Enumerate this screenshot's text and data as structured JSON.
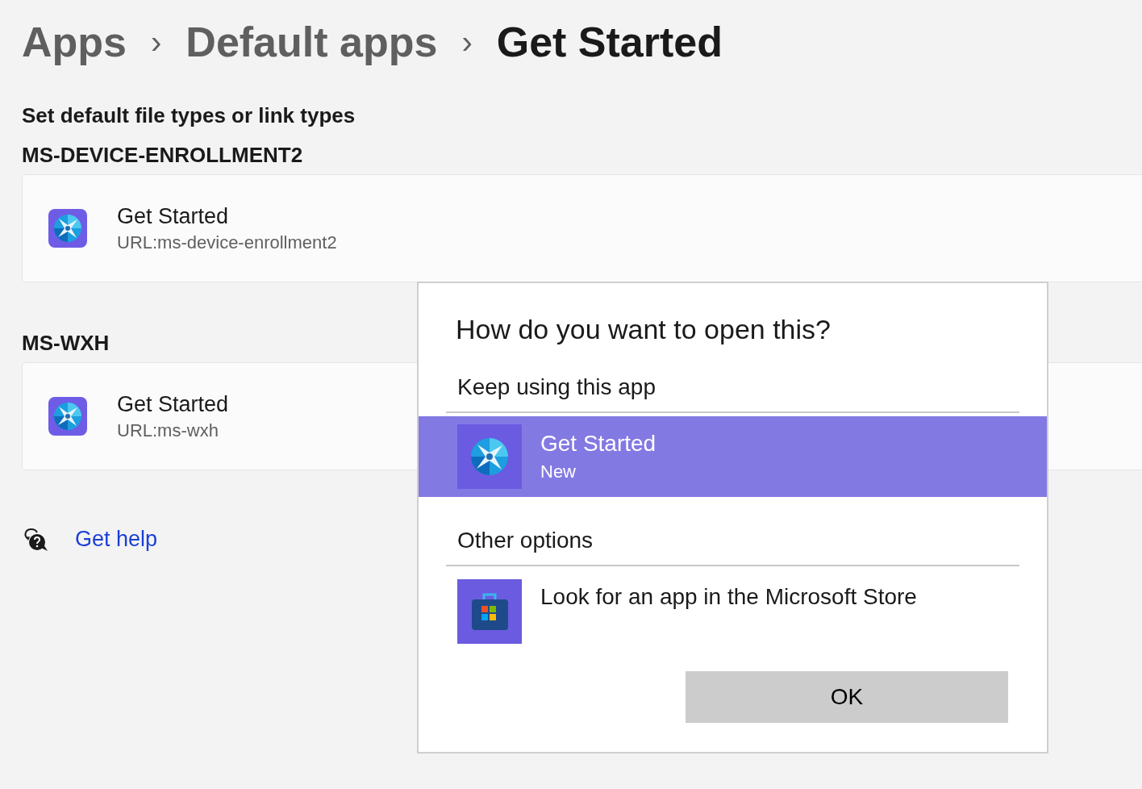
{
  "breadcrumb": [
    {
      "label": "Apps",
      "selected": false
    },
    {
      "label": "Default apps",
      "selected": false
    },
    {
      "label": "Get Started",
      "selected": true
    }
  ],
  "separator": "›",
  "subtitle": "Set default file types or link types",
  "sections": [
    {
      "heading": "MS-DEVICE-ENROLLMENT2",
      "app": {
        "name": "Get Started",
        "detail": "URL:ms-device-enrollment2"
      }
    },
    {
      "heading": "MS-WXH",
      "app": {
        "name": "Get Started",
        "detail": "URL:ms-wxh"
      }
    }
  ],
  "help_link": "Get help",
  "dialog": {
    "title": "How do you want to open this?",
    "groups": [
      {
        "heading": "Keep using this app",
        "options": [
          {
            "kind": "app",
            "name": "Get Started",
            "detail": "New",
            "selected": true
          }
        ]
      },
      {
        "heading": "Other options",
        "options": [
          {
            "kind": "store",
            "name": "Look for an app in the Microsoft Store",
            "selected": false
          }
        ]
      }
    ],
    "button": "OK"
  }
}
